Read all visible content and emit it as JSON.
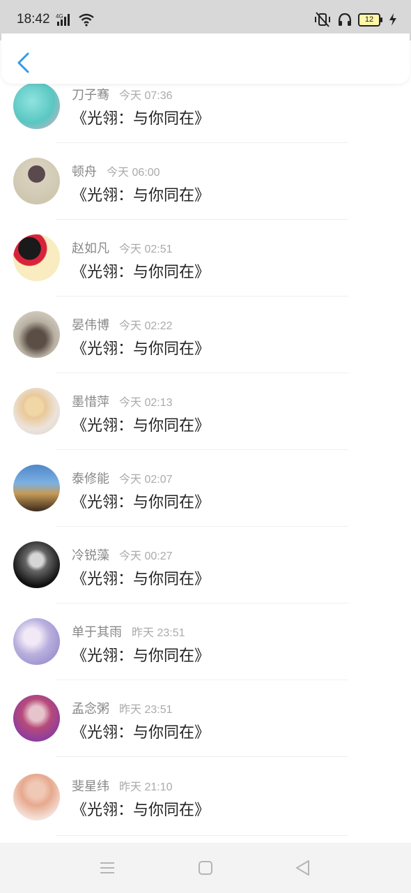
{
  "status_bar": {
    "time": "18:42",
    "network": "4G",
    "battery": "12"
  },
  "header": {
    "back_icon": "chevron-left-icon",
    "accent": "#2f9be8"
  },
  "comments": [
    {
      "name": "刀子骞",
      "time": "今天 07:36",
      "text": "《光翎：与你同在》"
    },
    {
      "name": "顿舟",
      "time": "今天 06:00",
      "text": "《光翎：与你同在》"
    },
    {
      "name": "赵如凡",
      "time": "今天 02:51",
      "text": "《光翎：与你同在》"
    },
    {
      "name": "晏伟博",
      "time": "今天 02:22",
      "text": "《光翎：与你同在》"
    },
    {
      "name": "墨惜萍",
      "time": "今天 02:13",
      "text": "《光翎：与你同在》"
    },
    {
      "name": "泰修能",
      "time": "今天 02:07",
      "text": "《光翎：与你同在》"
    },
    {
      "name": "冷锐藻",
      "time": "今天 00:27",
      "text": "《光翎：与你同在》"
    },
    {
      "name": "单于其雨",
      "time": "昨天 23:51",
      "text": "《光翎：与你同在》"
    },
    {
      "name": "孟念粥",
      "time": "昨天 23:51",
      "text": "《光翎：与你同在》"
    },
    {
      "name": "斐星纬",
      "time": "昨天 21:10",
      "text": "《光翎：与你同在》"
    }
  ],
  "nav": [
    "menu-icon",
    "home-icon",
    "back-icon"
  ]
}
